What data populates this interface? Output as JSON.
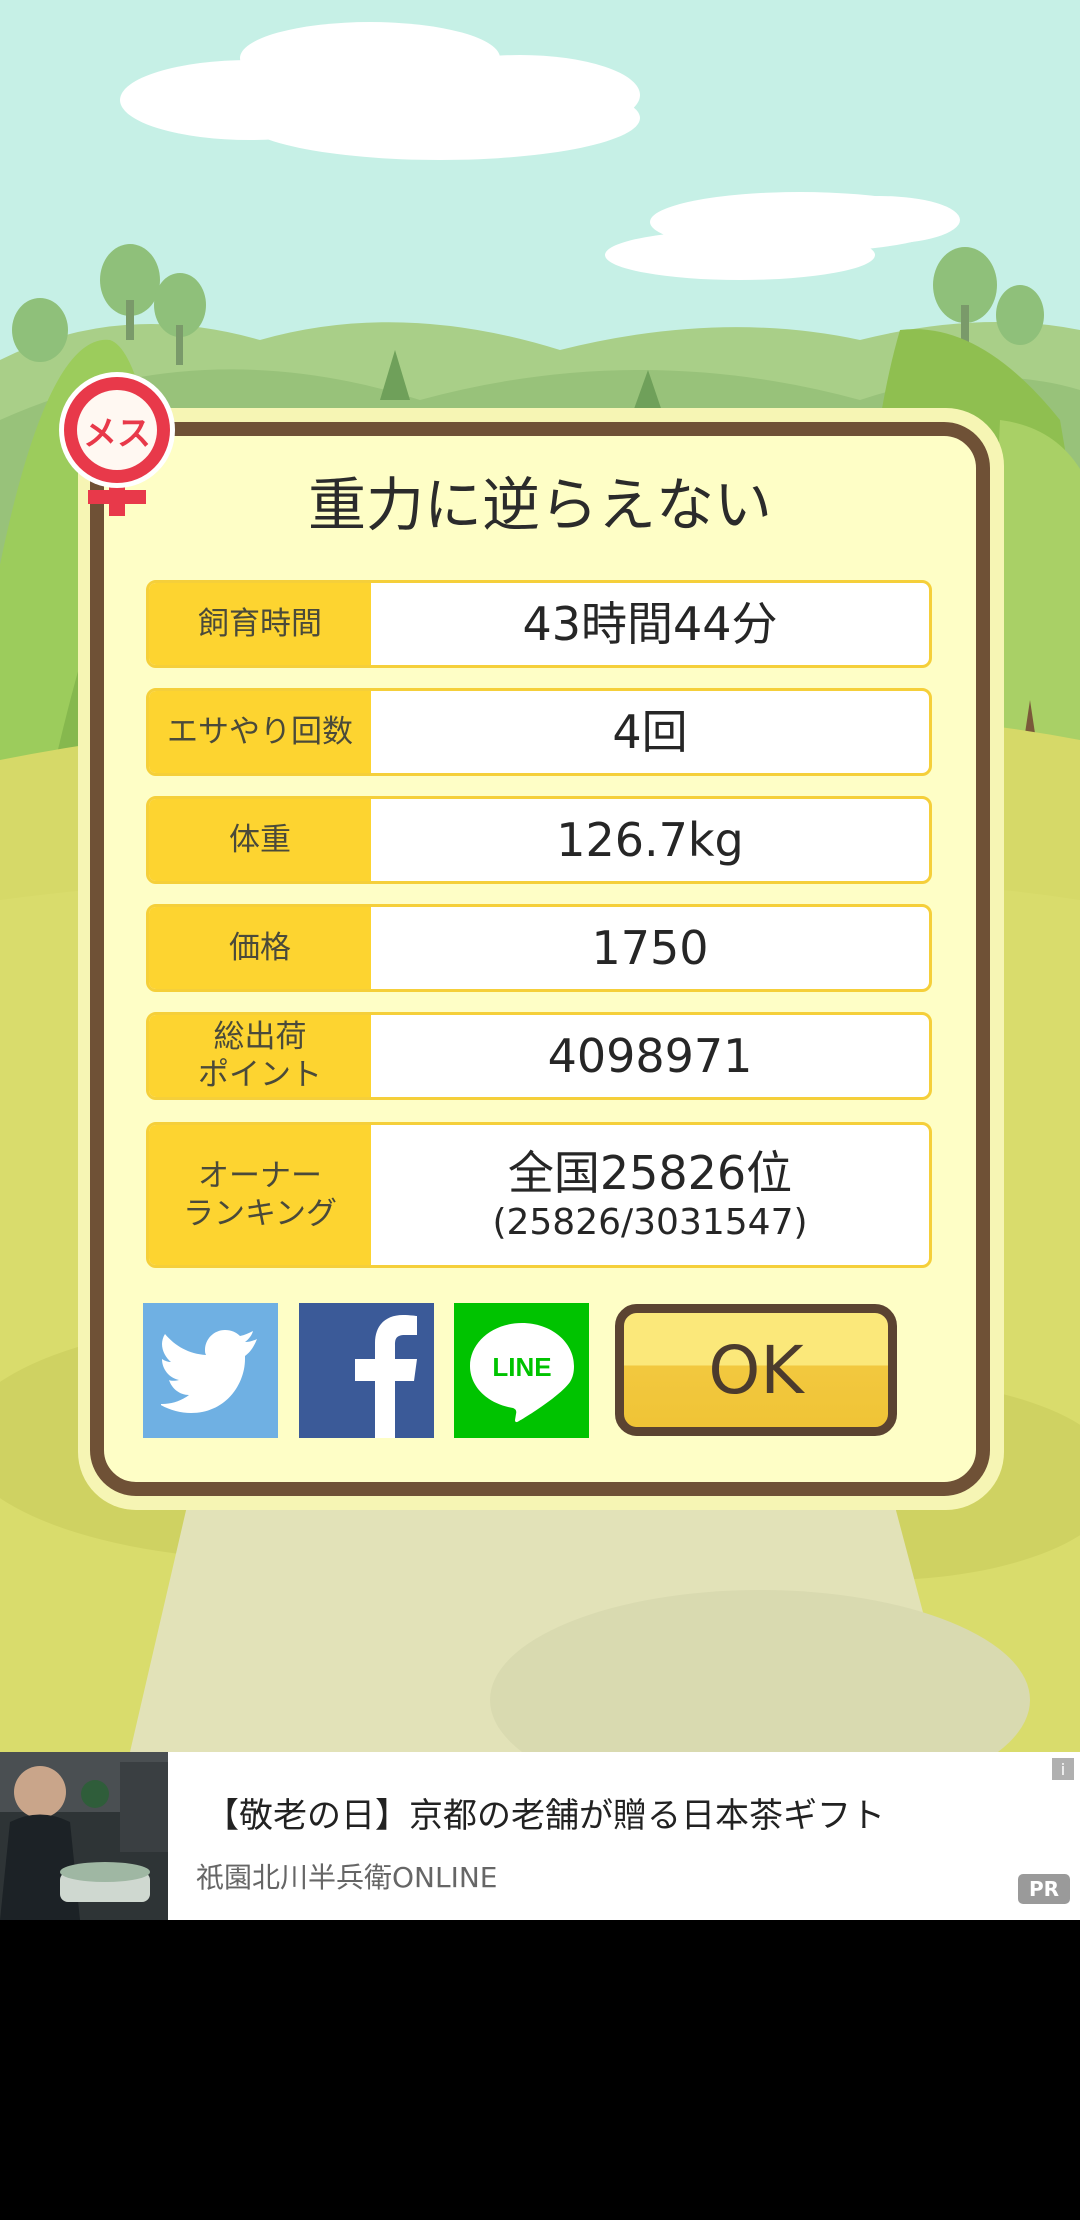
{
  "result": {
    "title": "重力に逆らえない",
    "badge_label": "メス",
    "rows": [
      {
        "label": "飼育時間",
        "value": "43時間44分"
      },
      {
        "label": "エサやり回数",
        "value": "4回"
      },
      {
        "label": "体重",
        "value": "126.7kg"
      },
      {
        "label": "価格",
        "value": "1750"
      },
      {
        "label": "総出荷\nポイント",
        "value": "4098971"
      },
      {
        "label": "オーナー\nランキング",
        "value": "全国25826位",
        "sub": "(25826/3031547)"
      }
    ]
  },
  "share": {
    "twitter_icon": "twitter-bird-icon",
    "facebook_icon": "facebook-f-icon",
    "line_label": "LINE"
  },
  "ok_label": "OK",
  "ad": {
    "title": "【敬老の日】京都の老舗が贈る日本茶ギフト",
    "sponsor": "祇園北川半兵衛ONLINE",
    "pr_label": "PR",
    "info_label": "i"
  },
  "colors": {
    "sky": "#c6f0e6",
    "card_border": "#6f5136",
    "card_fill": "#fefec6",
    "label_yellow": "#fdd430",
    "twitter": "#6fb0e3",
    "facebook": "#3b5a98",
    "line": "#00c300",
    "badge_red": "#e8394a"
  }
}
